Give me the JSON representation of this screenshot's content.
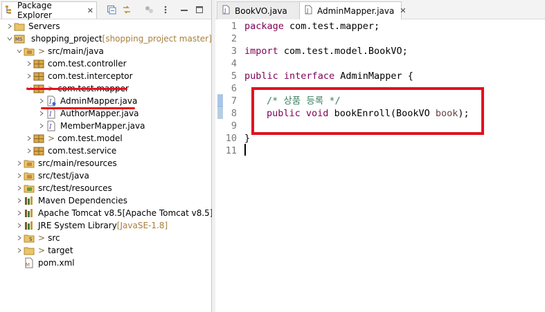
{
  "explorer": {
    "tab_label": "Package Explorer",
    "tab_close": "✕",
    "items": [
      {
        "label": "Servers",
        "suffix": "",
        "prefix": "",
        "icon": "server-folder-icon"
      },
      {
        "label": "shopping_project",
        "suffix": " [shopping_project master]",
        "prefix": "",
        "icon": "maven-project-icon"
      },
      {
        "label": "src/main/java",
        "suffix": "",
        "prefix": "> ",
        "icon": "source-folder-icon"
      },
      {
        "label": "com.test.controller",
        "suffix": "",
        "prefix": "",
        "icon": "package-icon"
      },
      {
        "label": "com.test.interceptor",
        "suffix": "",
        "prefix": "",
        "icon": "package-icon"
      },
      {
        "label": "com.test.mapper",
        "suffix": "",
        "prefix": "> ",
        "icon": "package-icon"
      },
      {
        "label": "AdminMapper.java",
        "suffix": "",
        "prefix": "",
        "icon": "java-interface-icon"
      },
      {
        "label": "AuthorMapper.java",
        "suffix": "",
        "prefix": "",
        "icon": "java-interface-icon"
      },
      {
        "label": "MemberMapper.java",
        "suffix": "",
        "prefix": "",
        "icon": "java-interface-icon"
      },
      {
        "label": "com.test.model",
        "suffix": "",
        "prefix": "> ",
        "icon": "package-icon"
      },
      {
        "label": "com.test.service",
        "suffix": "",
        "prefix": "",
        "icon": "package-icon"
      },
      {
        "label": "src/main/resources",
        "suffix": "",
        "prefix": "",
        "icon": "source-folder-icon"
      },
      {
        "label": "src/test/java",
        "suffix": "",
        "prefix": "",
        "icon": "source-folder-icon"
      },
      {
        "label": "src/test/resources",
        "suffix": "",
        "prefix": "",
        "icon": "source-folder-icon"
      },
      {
        "label": "Maven Dependencies",
        "suffix": "",
        "prefix": "",
        "icon": "library-icon"
      },
      {
        "label": "Apache Tomcat v8.5",
        "suffix": " [Apache Tomcat v8.5]",
        "prefix": "",
        "icon": "library-icon"
      },
      {
        "label": "JRE System Library",
        "suffix": " [JavaSE-1.8]",
        "prefix": "",
        "icon": "library-icon"
      },
      {
        "label": "src",
        "suffix": "",
        "prefix": "> ",
        "icon": "folder-icon"
      },
      {
        "label": "target",
        "suffix": "",
        "prefix": "> ",
        "icon": "folder-icon"
      },
      {
        "label": "pom.xml",
        "suffix": "",
        "prefix": "",
        "icon": "xml-file-icon"
      }
    ]
  },
  "editor": {
    "tabs": [
      {
        "label": "BookVO.java",
        "active": false
      },
      {
        "label": "AdminMapper.java",
        "active": true,
        "close": "✕"
      }
    ],
    "line_numbers": [
      "1",
      "2",
      "3",
      "4",
      "5",
      "6",
      "7",
      "8",
      "9",
      "10",
      "11"
    ],
    "code": {
      "l1_kw": "package",
      "l1_rest": " com.test.mapper;",
      "l3_kw": "import",
      "l3_rest": " com.test.model.BookVO;",
      "l5_kw1": "public",
      "l5_kw2": "interface",
      "l5_rest": " AdminMapper {",
      "l7_comment": "/* 상품 등록 */",
      "l8_kw1": "public",
      "l8_kw2": "void",
      "l8_mid": " bookEnroll(BookVO ",
      "l8_param": "book",
      "l8_end": ");",
      "l10": "}"
    }
  },
  "colors": {
    "keyword": "#7f0055",
    "comment": "#3f7f5f",
    "highlight_red": "#e3101e",
    "line_number": "#787878"
  }
}
